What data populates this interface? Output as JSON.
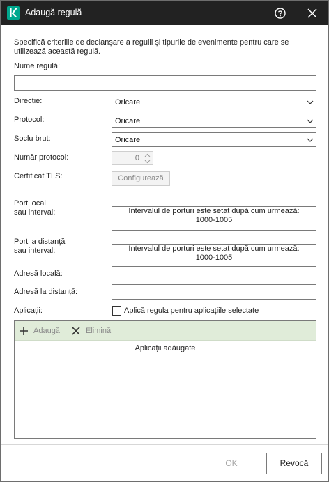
{
  "window": {
    "title": "Adaugă regulă"
  },
  "description": "Specifică criteriile de declanșare a regulii și tipurile de evenimente pentru care se utilizează această regulă.",
  "rule_name": {
    "label": "Nume regulă:",
    "value": ""
  },
  "direction": {
    "label": "Direcție:",
    "value": "Oricare"
  },
  "protocol": {
    "label": "Protocol:",
    "value": "Oricare"
  },
  "raw_socket": {
    "label": "Soclu brut:",
    "value": "Oricare"
  },
  "protocol_number": {
    "label": "Număr protocol:",
    "value": "0"
  },
  "tls_certificate": {
    "label": "Certificat TLS:",
    "button": "Configurează"
  },
  "local_port": {
    "label_line1": "Port local",
    "label_line2": "sau interval:",
    "value": "",
    "hint_line1": "Intervalul de porturi este setat după cum urmează:",
    "hint_line2": "1000-1005"
  },
  "remote_port": {
    "label_line1": "Port la distanță",
    "label_line2": "sau interval:",
    "value": "",
    "hint_line1": "Intervalul de porturi este setat după cum urmează:",
    "hint_line2": "1000-1005"
  },
  "local_address": {
    "label": "Adresă locală:",
    "value": ""
  },
  "remote_address": {
    "label": "Adresă la distanță:",
    "value": ""
  },
  "applications": {
    "label": "Aplicații:",
    "checkbox_label": "Aplică regula pentru aplicațiile selectate",
    "checked": false,
    "toolbar": {
      "add": "Adaugă",
      "remove": "Elimină"
    },
    "list_header": "Aplicații adăugate"
  },
  "footer": {
    "ok": "OK",
    "cancel": "Revocă"
  },
  "colors": {
    "titlebar": "#222222",
    "toolbar": "#e0ecd9",
    "brand": "#00a88e"
  },
  "icons": {
    "logo": "kaspersky-k-icon",
    "help": "help-circle-icon",
    "close": "close-icon",
    "dropdown": "chevron-down-icon",
    "add": "plus-icon",
    "remove": "x-icon"
  }
}
